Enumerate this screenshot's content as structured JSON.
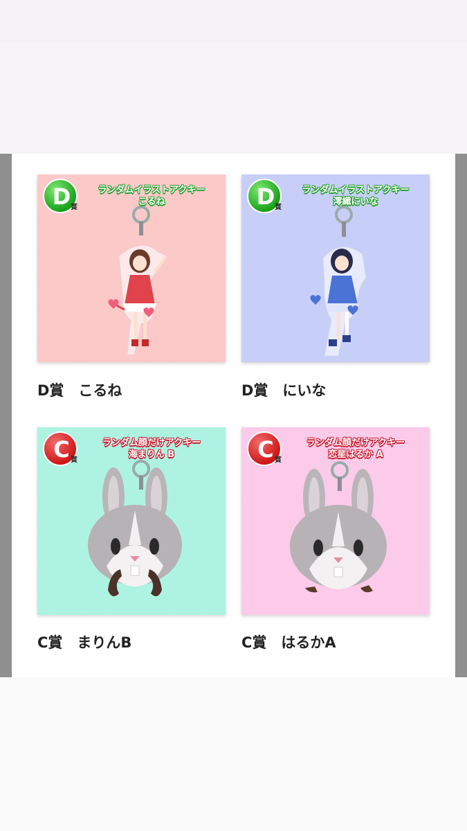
{
  "items": [
    {
      "badge_letter": "D",
      "badge_suffix": "賞",
      "product_line1": "ランダムイラストアクキー",
      "product_line2": "こるね",
      "caption": "D賞　こるね",
      "background_color": "#f6b2b2",
      "check_color": "#fcc9c9",
      "badge_color": "green",
      "art": "girl-acrylic-keychain-red"
    },
    {
      "badge_letter": "D",
      "badge_suffix": "賞",
      "product_line1": "ランダムイラストアクキー",
      "product_line2": "澪織にいな",
      "caption": "D賞　にいな",
      "background_color": "#b2bcf2",
      "check_color": "#c7cff8",
      "badge_color": "green",
      "art": "girl-acrylic-keychain-blue"
    },
    {
      "badge_letter": "C",
      "badge_suffix": "賞",
      "product_line1": "ランダム顔だけアクキー",
      "product_line2": "海まりん B",
      "caption": "C賞　まりんB",
      "background_color": "#8ee9d3",
      "check_color": "#aef3e2",
      "badge_color": "red",
      "art": "bunny-face-keychain-mustache"
    },
    {
      "badge_letter": "C",
      "badge_suffix": "賞",
      "product_line1": "ランダム顔だけアクキー",
      "product_line2": "恋星はるか A",
      "caption": "C賞　はるかA",
      "background_color": "#f9b5dc",
      "check_color": "#fccbe9",
      "badge_color": "red",
      "art": "bunny-face-keychain-hair"
    }
  ]
}
